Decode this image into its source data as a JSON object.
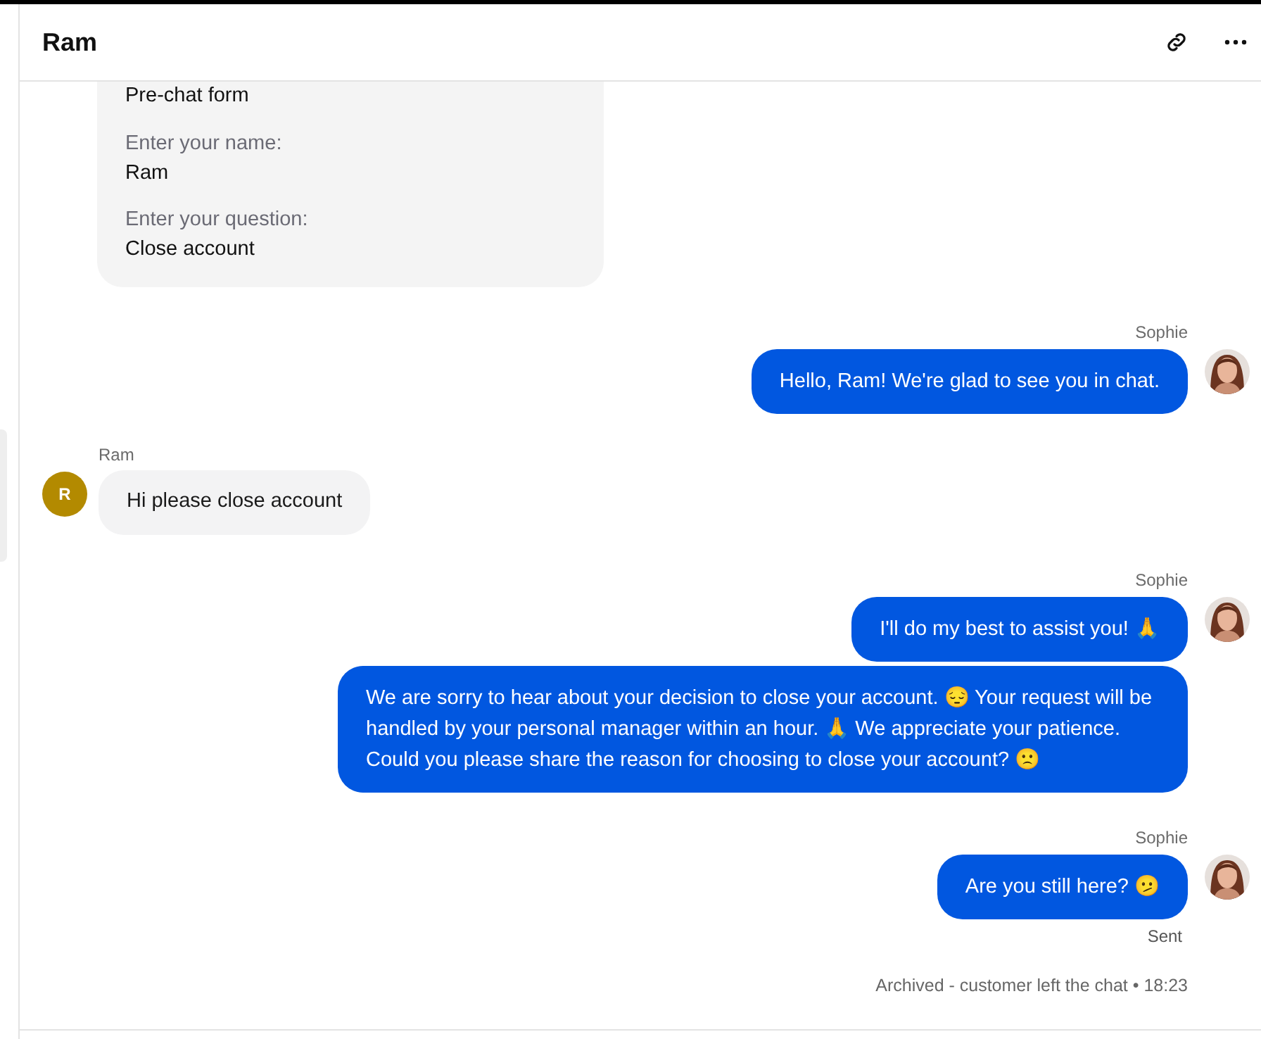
{
  "header": {
    "title": "Ram"
  },
  "form": {
    "title": "Pre-chat form",
    "fields": [
      {
        "label": "Enter your name:",
        "value": "Ram"
      },
      {
        "label": "Enter your question:",
        "value": "Close account"
      }
    ]
  },
  "groups": [
    {
      "kind": "agent",
      "author": "Sophie",
      "messages": [
        "Hello, Ram! We're glad to see you in chat."
      ]
    },
    {
      "kind": "customer",
      "author": "Ram",
      "initial": "R",
      "color": "#b38a00",
      "messages": [
        "Hi please close account"
      ]
    },
    {
      "kind": "agent",
      "author": "Sophie",
      "messages": [
        "I'll do my best to assist you! 🙏",
        "We are sorry to hear about your decision to close your account. 😔 Your request will be handled by your personal manager within an hour. 🙏 We appreciate your patience. Could you please share the reason for choosing to close your account? 🙁"
      ]
    },
    {
      "kind": "agent",
      "author": "Sophie",
      "messages": [
        "Are you still here? 🫤"
      ],
      "status": "Sent"
    }
  ],
  "footer_note": "Archived - customer left the chat • 18:23"
}
